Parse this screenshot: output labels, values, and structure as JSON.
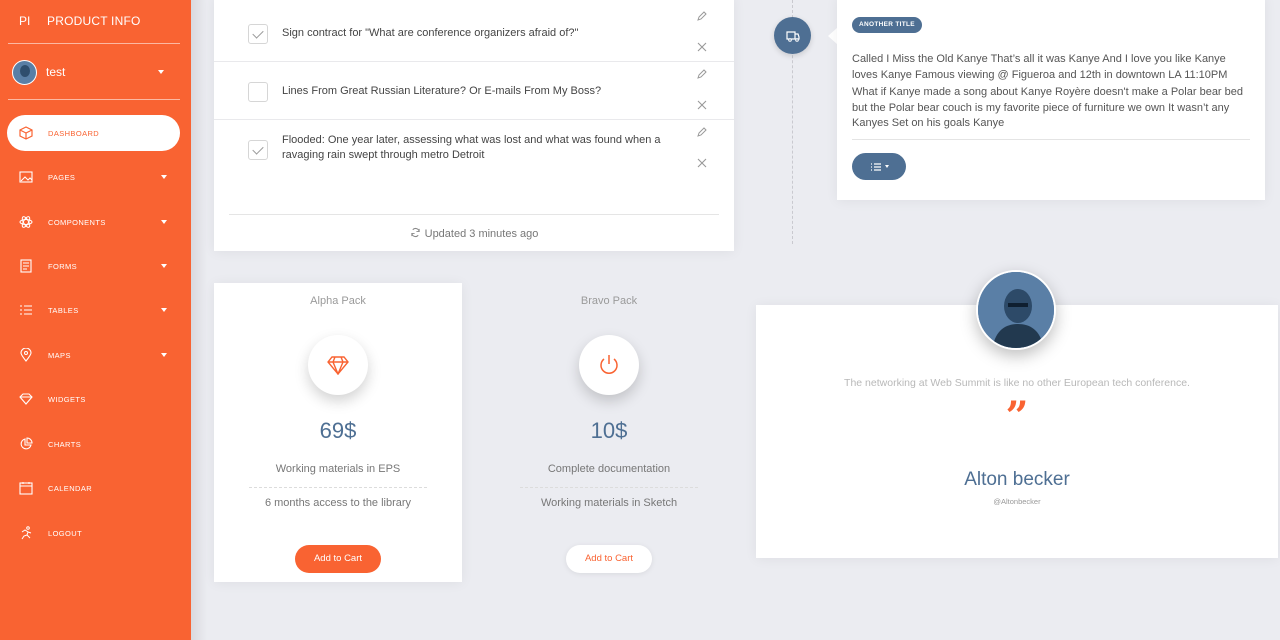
{
  "brand": {
    "mini": "PI",
    "title": "PRODUCT INFO"
  },
  "user": {
    "name": "test"
  },
  "sidebar": {
    "items": [
      {
        "label": "DASHBOARD",
        "icon": "cube-icon",
        "active": true
      },
      {
        "label": "PAGES",
        "icon": "image-icon",
        "has_caret": true
      },
      {
        "label": "COMPONENTS",
        "icon": "atom-icon",
        "has_caret": true
      },
      {
        "label": "FORMS",
        "icon": "document-icon",
        "has_caret": true
      },
      {
        "label": "TABLES",
        "icon": "list-icon",
        "has_caret": true
      },
      {
        "label": "MAPS",
        "icon": "pin-icon",
        "has_caret": true
      },
      {
        "label": "WIDGETS",
        "icon": "diamond-icon"
      },
      {
        "label": "CHARTS",
        "icon": "pie-chart-icon"
      },
      {
        "label": "CALENDAR",
        "icon": "calendar-icon"
      },
      {
        "label": "LOGOUT",
        "icon": "run-icon"
      }
    ]
  },
  "tasks": {
    "items": [
      {
        "text": "Sign contract for \"What are conference organizers afraid of?\"",
        "checked": true
      },
      {
        "text": "Lines From Great Russian Literature? Or E-mails From My Boss?",
        "checked": false
      },
      {
        "text": "Flooded: One year later, assessing what was lost and what was found when a ravaging rain swept through metro Detroit",
        "checked": true
      }
    ],
    "footer": "Updated 3 minutes ago"
  },
  "timeline": {
    "tag": "ANOTHER TITLE",
    "paragraph1": "Called I Miss the Old Kanye That’s all it was Kanye And I love you like Kanye loves Kanye Famous viewing @ Figueroa and 12th in downtown LA 11:10PM",
    "paragraph2": "What if Kanye made a song about Kanye Royère doesn't make a Polar bear bed but the Polar bear couch is my favorite piece of furniture we own It wasn’t any Kanyes Set on his goals Kanye"
  },
  "packs": [
    {
      "title": "Alpha Pack",
      "icon": "diamond-icon",
      "price": "69$",
      "feature1": "Working materials in EPS",
      "feature2": "6 months access to the library",
      "button": "Add to Cart"
    },
    {
      "title": "Bravo Pack",
      "icon": "power-icon",
      "price": "10$",
      "feature1": "Complete documentation",
      "feature2": "Working materials in Sketch",
      "button": "Add to Cart"
    }
  ],
  "testimonial": {
    "quote": "The networking at Web Summit is like no other European tech conference.",
    "mark": "”",
    "name": "Alton becker",
    "handle": "@Altonbecker"
  },
  "colors": {
    "accent": "#f96332",
    "primary": "#4e6f93",
    "background": "#ebecf1"
  }
}
